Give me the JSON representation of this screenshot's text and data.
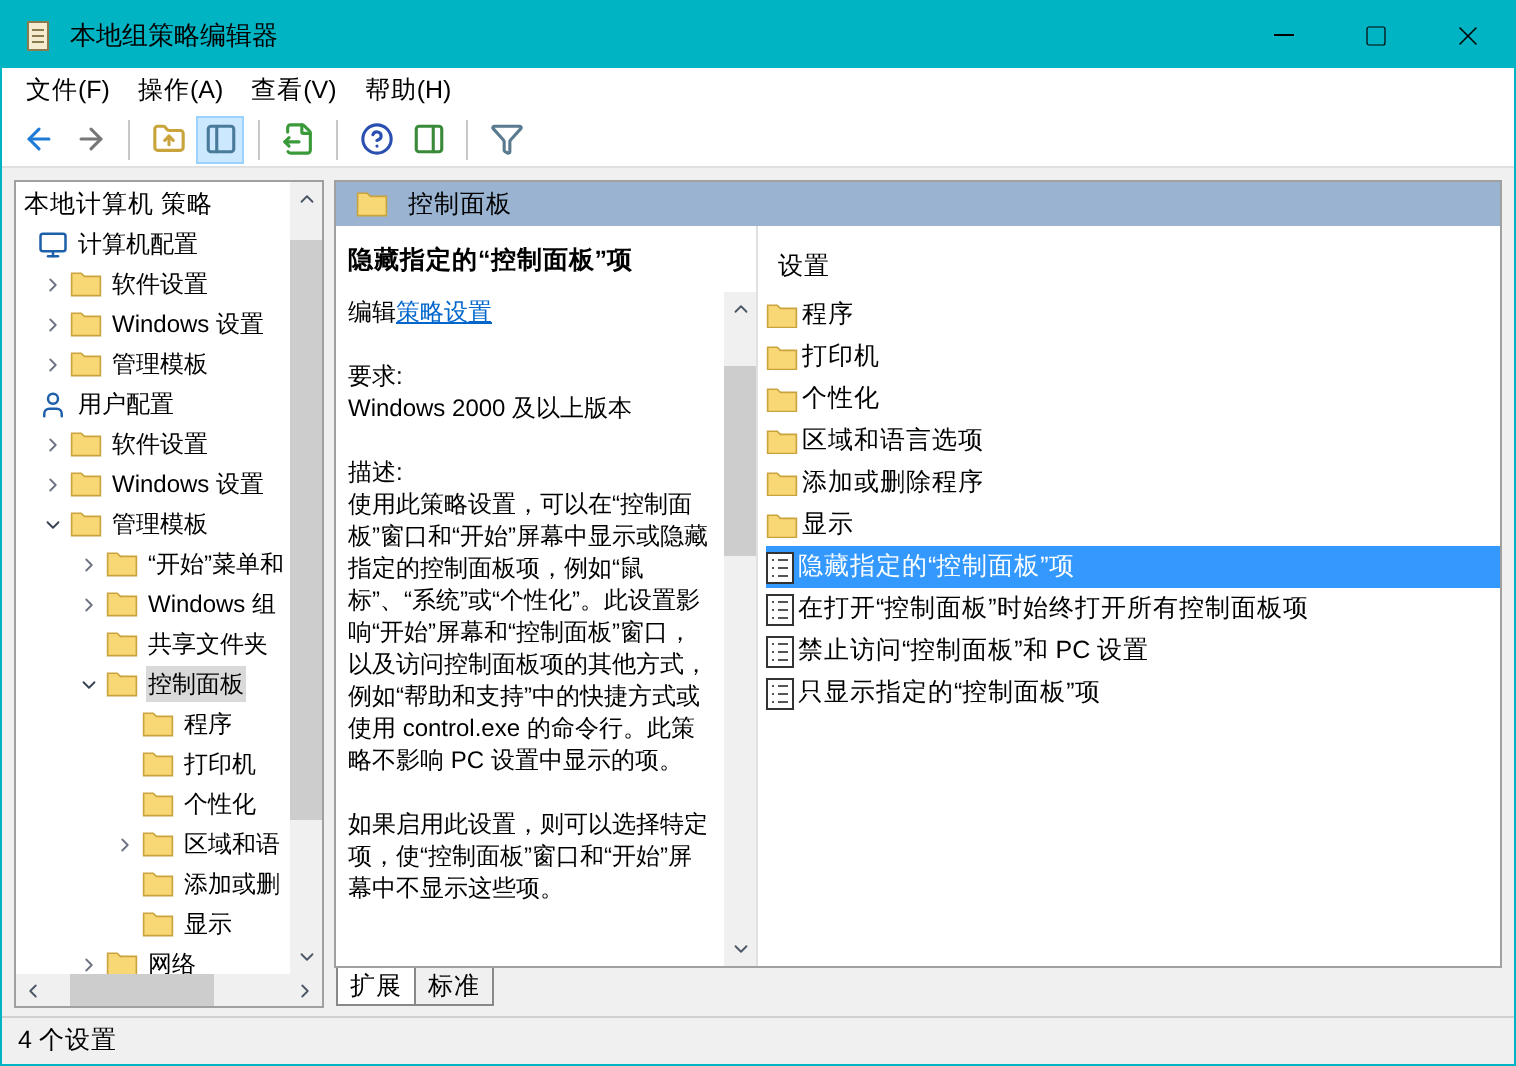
{
  "window": {
    "title": "本地组策略编辑器"
  },
  "menu": [
    "文件(F)",
    "操作(A)",
    "查看(V)",
    "帮助(H)"
  ],
  "toolbar": [
    {
      "kind": "back",
      "pressed": false
    },
    {
      "kind": "forward",
      "pressed": false
    },
    {
      "kind": "sep"
    },
    {
      "kind": "up",
      "pressed": false
    },
    {
      "kind": "tree",
      "pressed": true
    },
    {
      "kind": "sep"
    },
    {
      "kind": "export",
      "pressed": false
    },
    {
      "kind": "sep"
    },
    {
      "kind": "help",
      "pressed": false
    },
    {
      "kind": "pane",
      "pressed": false
    },
    {
      "kind": "sep"
    },
    {
      "kind": "filter",
      "pressed": false
    }
  ],
  "tree": {
    "root": "本地计算机 策略",
    "items": [
      {
        "label": "计算机配置",
        "kind": "computer",
        "selected": false,
        "children": [
          {
            "label": "软件设置",
            "kind": "folder",
            "expanded": false,
            "selected": false
          },
          {
            "label": "Windows 设置",
            "kind": "folder",
            "expanded": false,
            "selected": false
          },
          {
            "label": "管理模板",
            "kind": "folder",
            "expanded": false,
            "selected": false
          }
        ]
      },
      {
        "label": "用户配置",
        "kind": "user",
        "selected": false,
        "children": [
          {
            "label": "软件设置",
            "kind": "folder",
            "expanded": false,
            "selected": false
          },
          {
            "label": "Windows 设置",
            "kind": "folder",
            "expanded": false,
            "selected": false
          },
          {
            "label": "管理模板",
            "kind": "folder",
            "expanded": true,
            "selected": false,
            "children": [
              {
                "label": "“开始”菜单和",
                "kind": "folder",
                "expanded": false,
                "selected": false
              },
              {
                "label": "Windows 组",
                "kind": "folder",
                "expanded": false,
                "selected": false
              },
              {
                "label": "共享文件夹",
                "kind": "folder",
                "selected": false
              },
              {
                "label": "控制面板",
                "kind": "folder",
                "expanded": true,
                "selected": true,
                "children": [
                  {
                    "label": "程序",
                    "kind": "folder",
                    "selected": false
                  },
                  {
                    "label": "打印机",
                    "kind": "folder",
                    "selected": false
                  },
                  {
                    "label": "个性化",
                    "kind": "folder",
                    "selected": false
                  },
                  {
                    "label": "区域和语",
                    "kind": "folder",
                    "expanded": false,
                    "selected": false
                  },
                  {
                    "label": "添加或删",
                    "kind": "folder",
                    "selected": false
                  },
                  {
                    "label": "显示",
                    "kind": "folder",
                    "selected": false
                  }
                ]
              },
              {
                "label": "网络",
                "kind": "folder",
                "expanded": false,
                "selected": false
              }
            ]
          }
        ]
      }
    ]
  },
  "header": {
    "title": "控制面板"
  },
  "details": {
    "title": "隐藏指定的“控制面板”项",
    "edit_prefix": "编辑",
    "edit_link": "策略设置",
    "requirements_label": "要求:",
    "requirements": "Windows 2000 及以上版本",
    "description_label": "描述:",
    "paragraphs": [
      "使用此策略设置，可以在“控制面板”窗口和“开始”屏幕中显示或隐藏指定的控制面板项，例如“鼠标”、“系统”或“个性化”。此设置影响“开始”屏幕和“控制面板”窗口，以及访问控制面板项的其他方式，例如“帮助和支持”中的快捷方式或使用 control.exe 的命令行。此策略不影响 PC 设置中显示的项。",
      "如果启用此设置，则可以选择特定项，使“控制面板”窗口和“开始”屏幕中不显示这些项。"
    ]
  },
  "view_tabs": [
    {
      "label": "扩展",
      "selected": true
    },
    {
      "label": "标准",
      "selected": false
    }
  ],
  "list": {
    "column": "设置",
    "items": [
      {
        "label": "程序",
        "kind": "folder",
        "selected": false
      },
      {
        "label": "打印机",
        "kind": "folder",
        "selected": false
      },
      {
        "label": "个性化",
        "kind": "folder",
        "selected": false
      },
      {
        "label": "区域和语言选项",
        "kind": "folder",
        "selected": false
      },
      {
        "label": "添加或删除程序",
        "kind": "folder",
        "selected": false
      },
      {
        "label": "显示",
        "kind": "folder",
        "selected": false
      },
      {
        "label": "隐藏指定的“控制面板”项",
        "kind": "policy",
        "selected": true
      },
      {
        "label": "在打开“控制面板”时始终打开所有控制面板项",
        "kind": "policy",
        "selected": false
      },
      {
        "label": "禁止访问“控制面板”和 PC 设置",
        "kind": "policy",
        "selected": false
      },
      {
        "label": "只显示指定的“控制面板”项",
        "kind": "policy",
        "selected": false
      }
    ]
  },
  "status_bar": "4 个设置"
}
